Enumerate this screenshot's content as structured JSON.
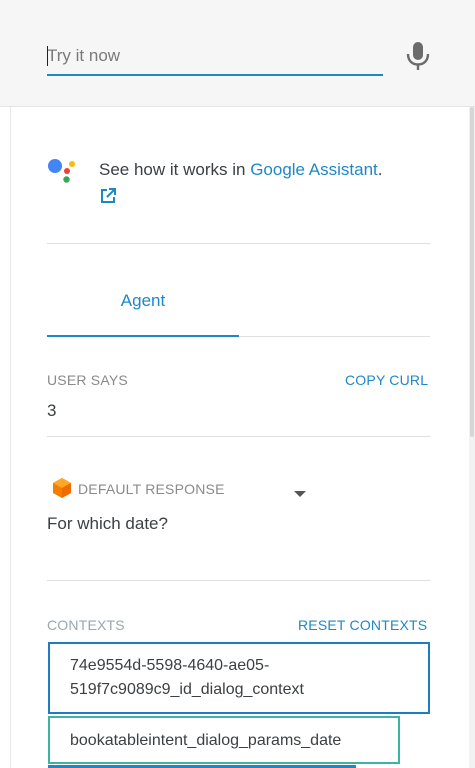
{
  "try_bar": {
    "placeholder": "Try it now"
  },
  "assistant": {
    "prefix": "See how it works in ",
    "link_text": "Google Assistant",
    "suffix": "."
  },
  "tabs": [
    {
      "label": "Agent",
      "selected": true
    }
  ],
  "user_says": {
    "label": "USER SAYS",
    "action": "COPY CURL",
    "value": "3"
  },
  "response": {
    "label": "DEFAULT RESPONSE",
    "value": "For which date?"
  },
  "contexts": {
    "label": "CONTEXTS",
    "action": "RESET CONTEXTS",
    "items": [
      "74e9554d-5598-4640-ae05-519f7c9089c9_id_dialog_context",
      "bookatableintent_dialog_params_date"
    ]
  },
  "colors": {
    "accent": "#1e88c7",
    "context_border_1": "#1e7cc2",
    "context_border_2": "#3fb3a3",
    "dialogflow_orange": "#f57c00"
  },
  "icons": {
    "mic": "microphone-icon",
    "assistant_logo": "google-assistant-icon",
    "external_link": "external-link-icon",
    "response_source": "dialogflow-icon",
    "dropdown": "caret-down-icon"
  }
}
